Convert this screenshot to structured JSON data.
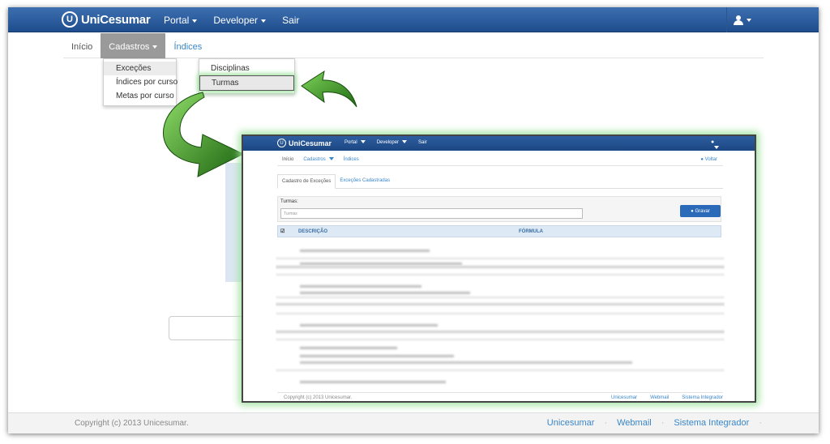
{
  "brand": {
    "name": "UniCesumar",
    "logo_letter": "U"
  },
  "topnav": {
    "items": [
      {
        "label": "Portal",
        "has_caret": true
      },
      {
        "label": "Developer",
        "has_caret": true
      },
      {
        "label": "Sair",
        "has_caret": false
      }
    ],
    "user_icon": "user-icon"
  },
  "subnav": {
    "inicio": "Início",
    "cadastros": "Cadastros",
    "indices": "Índices"
  },
  "dropdown": {
    "items": [
      "Exceções",
      "Índices por curso",
      "Metas por curso"
    ]
  },
  "submenu": {
    "items": [
      "Disciplinas",
      "Turmas"
    ]
  },
  "footer": {
    "copyright": "Copyright (c) 2013 Unicesumar.",
    "links": [
      "Unicesumar",
      "Webmail",
      "Sistema Integrador"
    ]
  },
  "inset": {
    "brand": "UniCesumar",
    "nav": [
      "Portal",
      "Developer",
      "Sair"
    ],
    "subnav": [
      "Início",
      "Cadastros",
      "Índices"
    ],
    "voltar": "Voltar",
    "tabs": [
      "Cadastro de Exceções",
      "Exceções Cadastradas"
    ],
    "turmas_label": "Turmas:",
    "turmas_placeholder": "Turmas",
    "gravar": "Gravar",
    "columns": [
      "DESCRIÇÃO",
      "FÓRMULA"
    ],
    "footer_copy": "Copyright (c) 2013 Unicesumar.",
    "footer_links": [
      "Unicesumar",
      "Webmail",
      "Sistema Integrador"
    ]
  },
  "colors": {
    "nav_blue": "#1f4d8d",
    "link_blue": "#3a86c8",
    "arrow_green": "#2e8a1e",
    "highlight_glow": "#9be29b"
  }
}
